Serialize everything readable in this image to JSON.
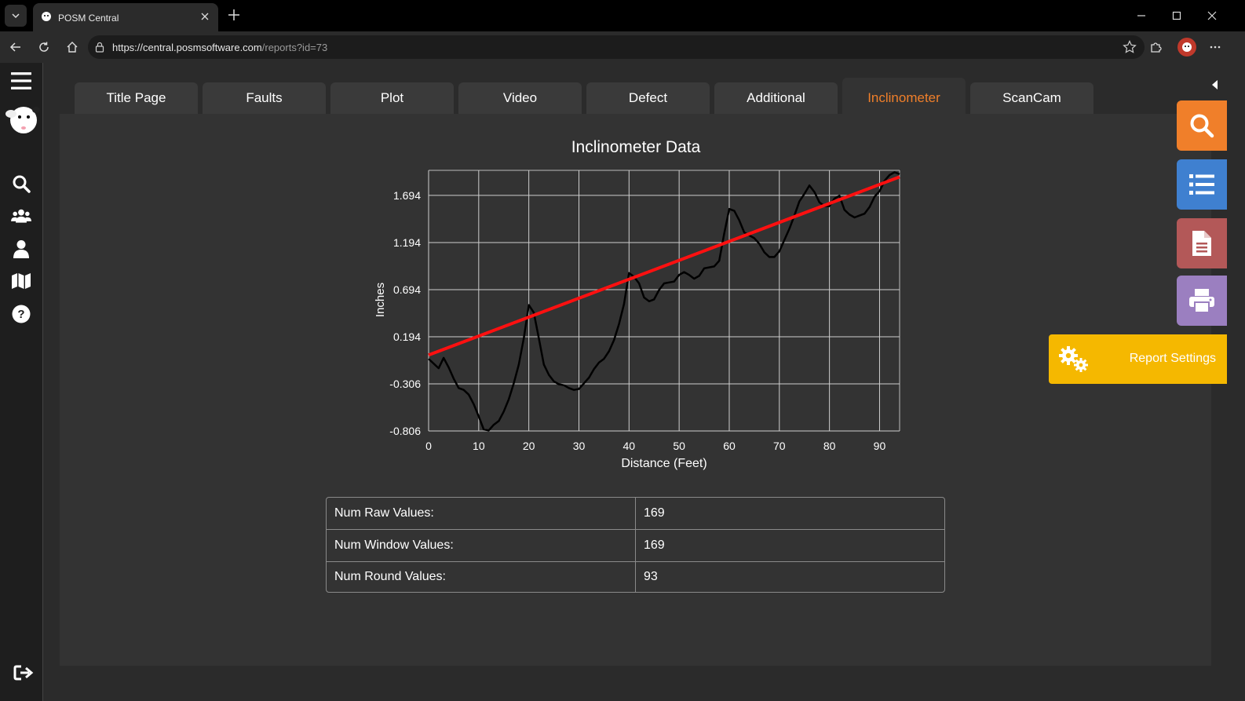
{
  "browser": {
    "tab_title": "POSM Central",
    "url_host": "https://central.posmsoftware.com",
    "url_path": "/reports?id=73"
  },
  "report_tabs": [
    {
      "label": "Title Page",
      "active": false
    },
    {
      "label": "Faults",
      "active": false
    },
    {
      "label": "Plot",
      "active": false
    },
    {
      "label": "Video",
      "active": false
    },
    {
      "label": "Defect",
      "active": false
    },
    {
      "label": "Additional",
      "active": false
    },
    {
      "label": "Inclinometer",
      "active": true
    },
    {
      "label": "ScanCam",
      "active": false
    }
  ],
  "side_nav": [
    "menu-icon",
    "logo",
    "search-icon",
    "users-icon",
    "user-icon",
    "map-icon",
    "help-icon",
    "logout-icon"
  ],
  "floating_buttons": [
    {
      "name": "search-button",
      "icon": "search-icon",
      "color": "#f07f2a"
    },
    {
      "name": "list-button",
      "icon": "list-icon",
      "color": "#3f80d0"
    },
    {
      "name": "document-button",
      "icon": "document-icon",
      "color": "#b35858"
    },
    {
      "name": "print-button",
      "icon": "printer-icon",
      "color": "#9b7fc0"
    }
  ],
  "report_settings": {
    "label": "Report Settings",
    "color": "#f5b800"
  },
  "chart_data": {
    "type": "line",
    "title": "Inclinometer Data",
    "xlabel": "Distance (Feet)",
    "ylabel": "Inches",
    "xlim": [
      0,
      94
    ],
    "ylim": [
      -0.806,
      1.96
    ],
    "x_ticks": [
      0,
      10,
      20,
      30,
      40,
      50,
      60,
      70,
      80,
      90
    ],
    "y_ticks": [
      -0.806,
      -0.306,
      0.194,
      0.694,
      1.194,
      1.694
    ],
    "y_tick_labels": [
      "-0.806",
      "-0.306",
      "0.194",
      "0.694",
      "1.194",
      "1.694"
    ],
    "grid": true,
    "series": [
      {
        "color": "#000000",
        "x": [
          0,
          2,
          3,
          4,
          5,
          6,
          7,
          8,
          9,
          10,
          11,
          12,
          13,
          14,
          15,
          16,
          17,
          18,
          19,
          20,
          21,
          22,
          23,
          24,
          25,
          26,
          27,
          28,
          29,
          30,
          31,
          32,
          33,
          34,
          35,
          36,
          37,
          38,
          39,
          40,
          41,
          42,
          43,
          44,
          45,
          46,
          47,
          48,
          49,
          50,
          51,
          52,
          53,
          54,
          55,
          56,
          57,
          58,
          59,
          60,
          61,
          62,
          63,
          64,
          65,
          66,
          67,
          68,
          69,
          70,
          71,
          72,
          73,
          74,
          75,
          76,
          77,
          78,
          79,
          80,
          81,
          82,
          83,
          84,
          85,
          86,
          87,
          88,
          89,
          90,
          91,
          92,
          93,
          94
        ],
        "y": [
          -0.04,
          -0.14,
          -0.03,
          -0.13,
          -0.25,
          -0.35,
          -0.37,
          -0.42,
          -0.52,
          -0.65,
          -0.79,
          -0.8,
          -0.74,
          -0.7,
          -0.6,
          -0.47,
          -0.3,
          -0.1,
          0.18,
          0.53,
          0.45,
          0.18,
          -0.1,
          -0.21,
          -0.28,
          -0.31,
          -0.32,
          -0.35,
          -0.37,
          -0.36,
          -0.3,
          -0.24,
          -0.15,
          -0.08,
          -0.04,
          0.04,
          0.16,
          0.33,
          0.54,
          0.87,
          0.83,
          0.76,
          0.61,
          0.57,
          0.59,
          0.69,
          0.76,
          0.77,
          0.78,
          0.85,
          0.88,
          0.85,
          0.81,
          0.84,
          0.92,
          0.93,
          0.94,
          1.0,
          1.29,
          1.55,
          1.53,
          1.43,
          1.3,
          1.27,
          1.24,
          1.18,
          1.09,
          1.04,
          1.04,
          1.1,
          1.22,
          1.34,
          1.48,
          1.63,
          1.71,
          1.8,
          1.73,
          1.62,
          1.58,
          1.58,
          1.66,
          1.69,
          1.54,
          1.49,
          1.46,
          1.48,
          1.5,
          1.57,
          1.68,
          1.74,
          1.85,
          1.91,
          1.94,
          1.92
        ]
      },
      {
        "color": "#ff1010",
        "x": [
          0,
          94
        ],
        "y": [
          0.0,
          1.89
        ]
      }
    ]
  },
  "stats": [
    {
      "label": "Num Raw Values:",
      "value": "169"
    },
    {
      "label": "Num Window Values:",
      "value": "169"
    },
    {
      "label": "Num Round Values:",
      "value": "93"
    }
  ]
}
